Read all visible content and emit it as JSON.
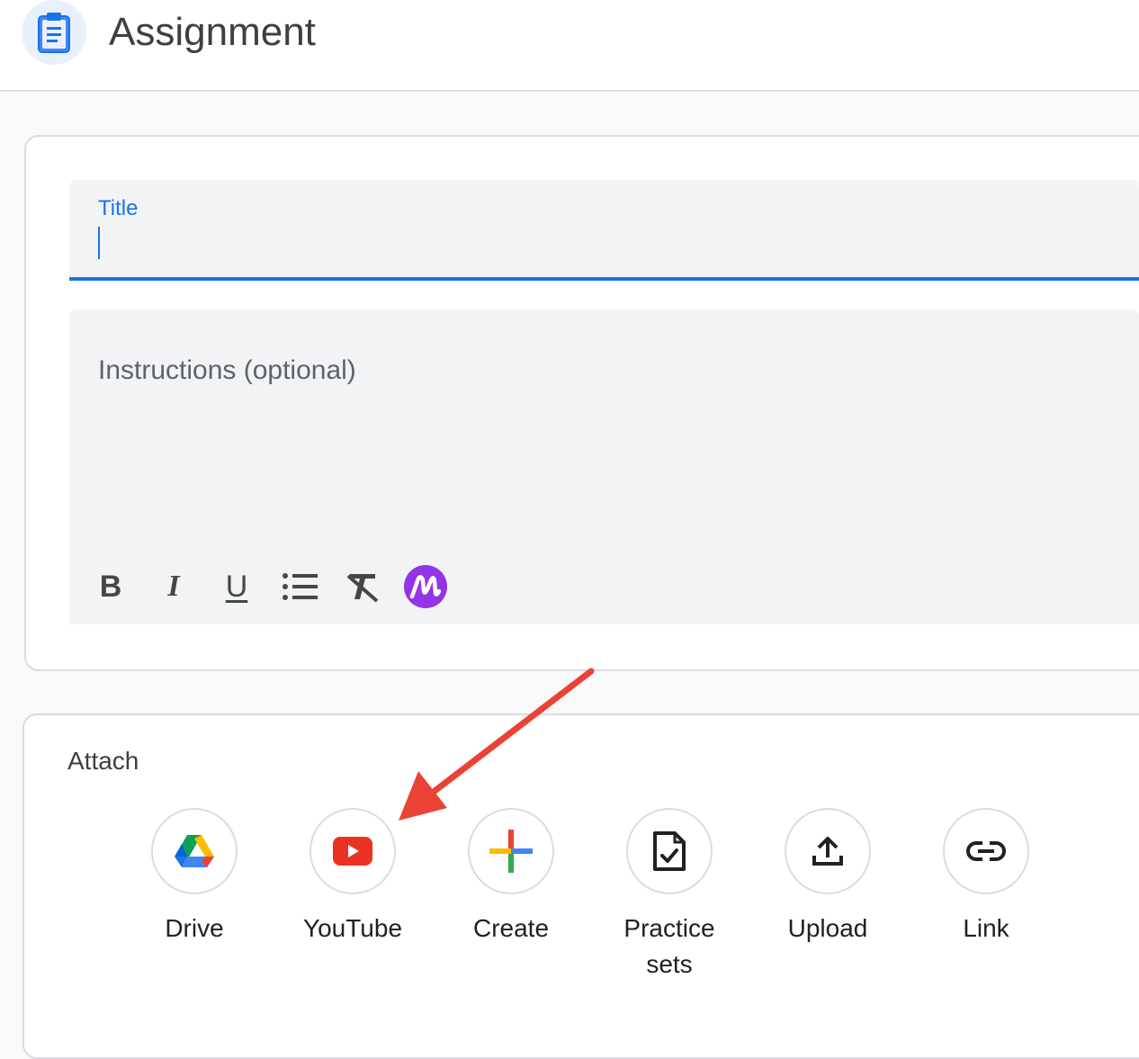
{
  "header": {
    "title": "Assignment",
    "icon": "assignment-icon",
    "icon_color": "#1a73e8"
  },
  "form": {
    "title_label": "Title",
    "title_value": "",
    "instructions_placeholder": "Instructions (optional)",
    "toolbar": [
      {
        "name": "bold",
        "label": "B"
      },
      {
        "name": "italic",
        "label": "I"
      },
      {
        "name": "underline",
        "label": "U"
      },
      {
        "name": "bulleted-list",
        "icon": "list-icon"
      },
      {
        "name": "clear-formatting",
        "icon": "clear-format-icon"
      },
      {
        "name": "extension",
        "icon": "extension-m-icon",
        "color": "#9334e6"
      }
    ]
  },
  "attach": {
    "label": "Attach",
    "items": [
      {
        "label": "Drive",
        "icon": "drive-icon"
      },
      {
        "label": "YouTube",
        "icon": "youtube-icon"
      },
      {
        "label": "Create",
        "icon": "create-plus-icon"
      },
      {
        "label": "Practice sets",
        "icon": "practice-sets-icon"
      },
      {
        "label": "Upload",
        "icon": "upload-icon"
      },
      {
        "label": "Link",
        "icon": "link-icon"
      }
    ]
  },
  "annotation": {
    "icon": "red-arrow-icon",
    "color": "#ea4335"
  },
  "colors": {
    "accent": "#1a73e8",
    "youtube_red": "#ea3323"
  }
}
